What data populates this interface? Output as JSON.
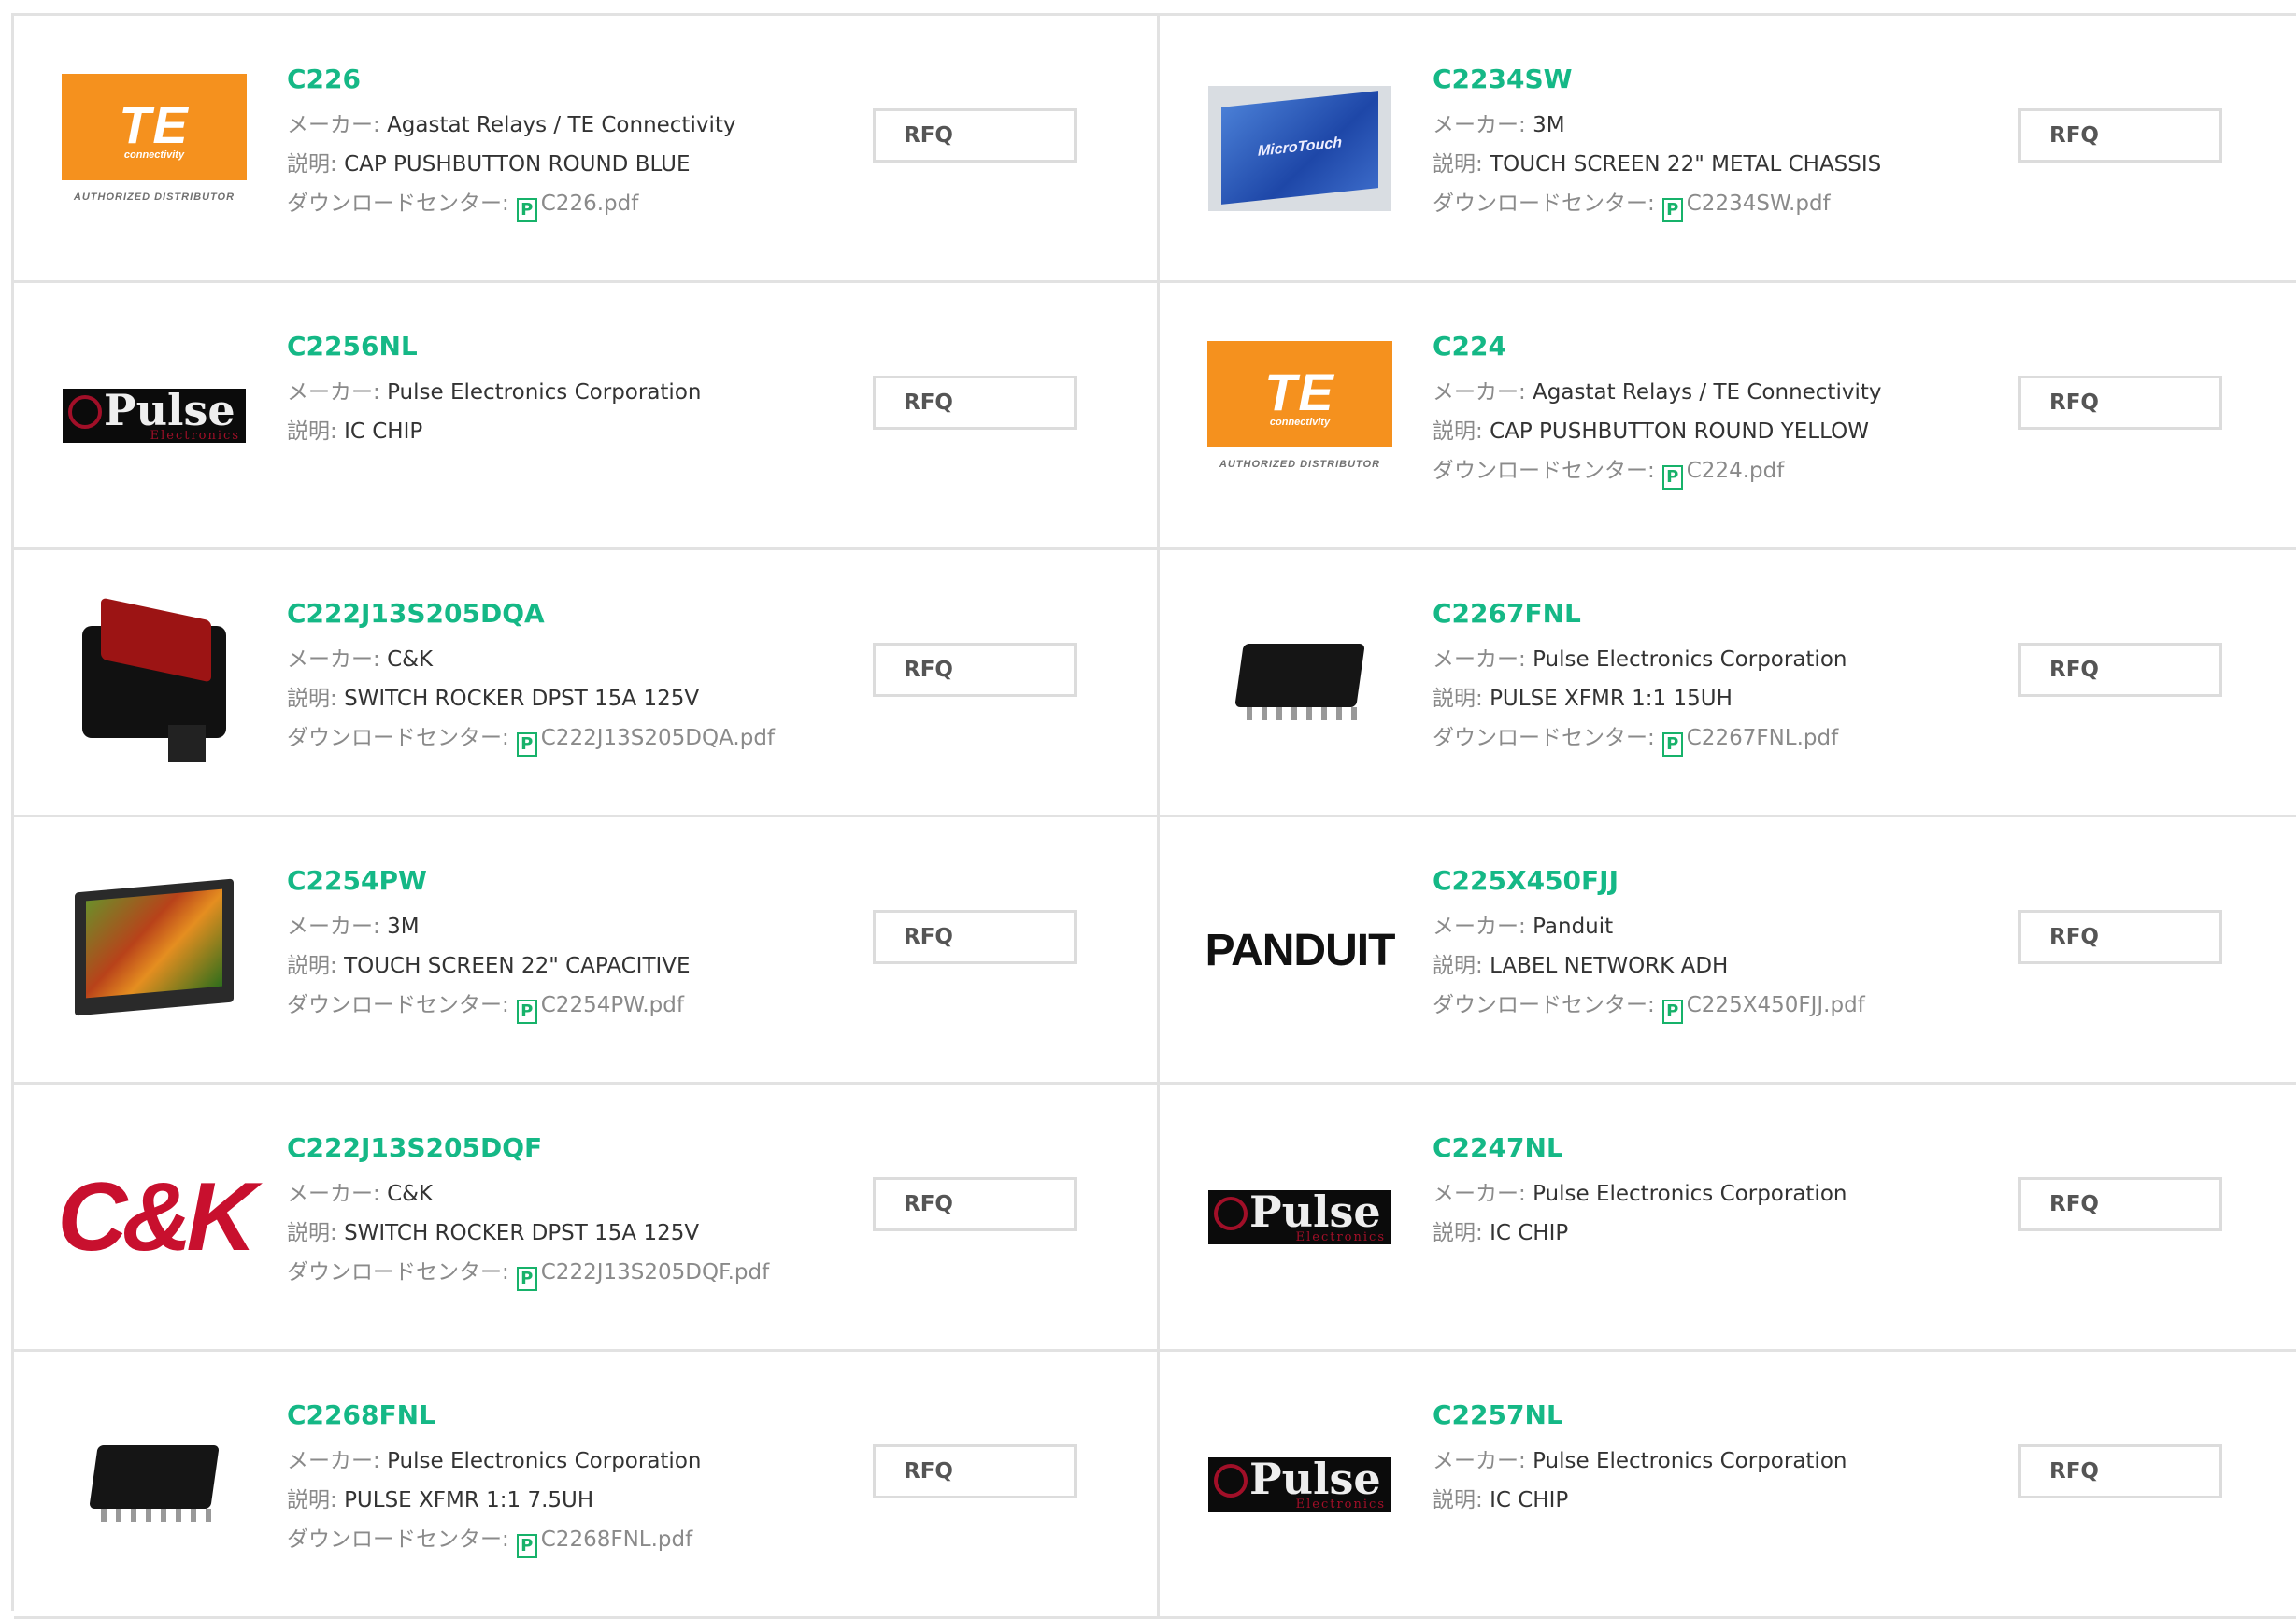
{
  "labels": {
    "maker": "メーカー:",
    "desc": "説明:",
    "download": "ダウンロードセンター:",
    "pdf_icon_letter": "P"
  },
  "rfq_label": "RFQ",
  "items": [
    {
      "pn": "C226",
      "maker": "Agastat Relays / TE Connectivity",
      "desc": "CAP PUSHBUTTON ROUND BLUE",
      "file": "C226.pdf",
      "thumb": "te-logo"
    },
    {
      "pn": "C2234SW",
      "maker": "3M",
      "desc": "TOUCH SCREEN 22\" METAL CHASSIS",
      "file": "C2234SW.pdf",
      "thumb": "microtouch-monitor"
    },
    {
      "pn": "C2256NL",
      "maker": "Pulse Electronics Corporation",
      "desc": "IC CHIP",
      "file": null,
      "thumb": "pulse-logo"
    },
    {
      "pn": "C224",
      "maker": "Agastat Relays / TE Connectivity",
      "desc": "CAP PUSHBUTTON ROUND YELLOW",
      "file": "C224.pdf",
      "thumb": "te-logo"
    },
    {
      "pn": "C222J13S205DQA",
      "maker": "C&K",
      "desc": "SWITCH ROCKER DPST 15A 125V",
      "file": "C222J13S205DQA.pdf",
      "thumb": "rocker-switch"
    },
    {
      "pn": "C2267FNL",
      "maker": "Pulse Electronics Corporation",
      "desc": "PULSE XFMR 1:1 15UH",
      "file": "C2267FNL.pdf",
      "thumb": "chip"
    },
    {
      "pn": "C2254PW",
      "maker": "3M",
      "desc": "TOUCH SCREEN 22\" CAPACITIVE",
      "file": "C2254PW.pdf",
      "thumb": "tft-screen"
    },
    {
      "pn": "C225X450FJJ",
      "maker": "Panduit",
      "desc": "LABEL NETWORK ADH",
      "file": "C225X450FJJ.pdf",
      "thumb": "panduit-logo"
    },
    {
      "pn": "C222J13S205DQF",
      "maker": "C&K",
      "desc": "SWITCH ROCKER DPST 15A 125V",
      "file": "C222J13S205DQF.pdf",
      "thumb": "ck-logo"
    },
    {
      "pn": "C2247NL",
      "maker": "Pulse Electronics Corporation",
      "desc": "IC CHIP",
      "file": null,
      "thumb": "pulse-logo"
    },
    {
      "pn": "C2268FNL",
      "maker": "Pulse Electronics Corporation",
      "desc": "PULSE XFMR 1:1 7.5UH",
      "file": "C2268FNL.pdf",
      "thumb": "chip"
    },
    {
      "pn": "C2257NL",
      "maker": "Pulse Electronics Corporation",
      "desc": "IC CHIP",
      "file": null,
      "thumb": "pulse-logo"
    }
  ],
  "logos": {
    "te_main": "TE",
    "te_small": "connectivity",
    "te_sub": "AUTHORIZED DISTRIBUTOR",
    "pulse_main": "Pulse",
    "pulse_sub": "Electronics",
    "ck": "C&K",
    "panduit": "PANDUIT",
    "microtouch": "MicroTouch"
  },
  "colors": {
    "part_number": "#15b886",
    "border": "#e2e2e2",
    "te_orange": "#f5911e",
    "pulse_red": "#a10f28",
    "ck_red": "#c8102e"
  }
}
